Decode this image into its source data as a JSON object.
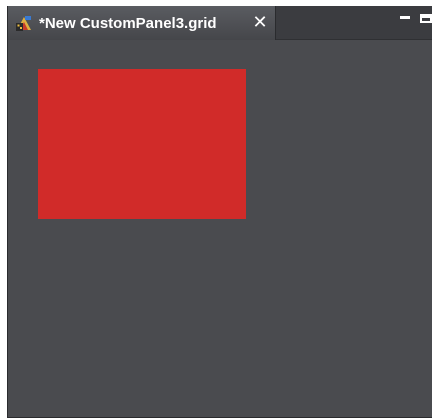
{
  "tab": {
    "title": "*New CustomPanel3.grid",
    "icon": "grid-document-icon",
    "close_label": "✕"
  },
  "window_controls": {
    "minimize": "minimize-icon",
    "maximize": "maximize-icon"
  },
  "canvas": {
    "background_color": "#4a4b4f",
    "panel_color": "#d12b29"
  }
}
